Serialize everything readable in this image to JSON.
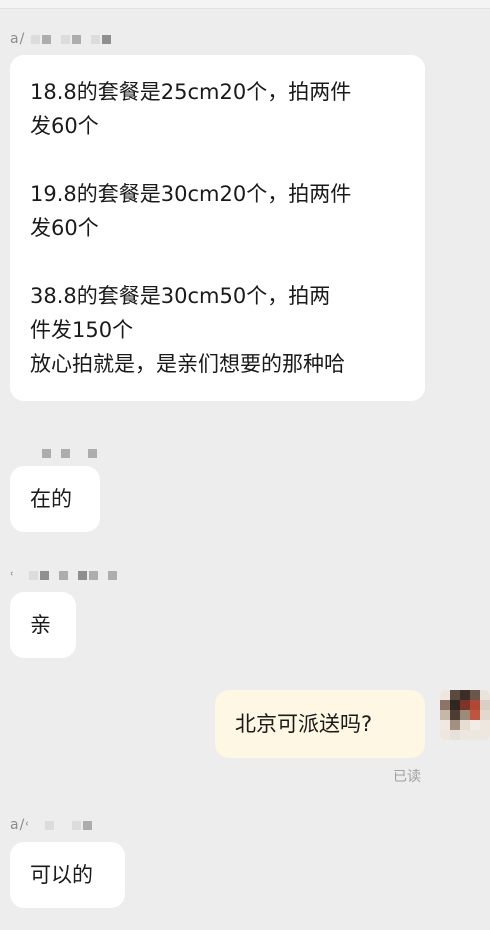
{
  "chat": {
    "messages": [
      {
        "id": "m1",
        "direction": "incoming",
        "sender_visible": "a/",
        "lines": [
          "18.8的套餐是25cm20个，拍两件",
          "发60个",
          "",
          "19.8的套餐是30cm20个，拍两件",
          "发60个",
          "",
          "38.8的套餐是30cm50个，拍两",
          "件发150个",
          "放心拍就是，是亲们想要的那种哈"
        ]
      },
      {
        "id": "m2",
        "direction": "incoming",
        "sender_visible": "",
        "lines": [
          "在的"
        ]
      },
      {
        "id": "m3",
        "direction": "incoming",
        "sender_visible": "˓",
        "lines": [
          "亲"
        ]
      },
      {
        "id": "m4",
        "direction": "outgoing",
        "lines": [
          "北京可派送吗?"
        ],
        "status": "已读"
      },
      {
        "id": "m5",
        "direction": "incoming",
        "sender_visible": "a/˓",
        "lines": [
          "可以的"
        ]
      }
    ]
  },
  "colors": {
    "background": "#ededed",
    "incoming_bubble": "#ffffff",
    "outgoing_bubble": "#fdf7e3",
    "text": "#1a1a1a",
    "status_text": "#a0a0a0"
  }
}
